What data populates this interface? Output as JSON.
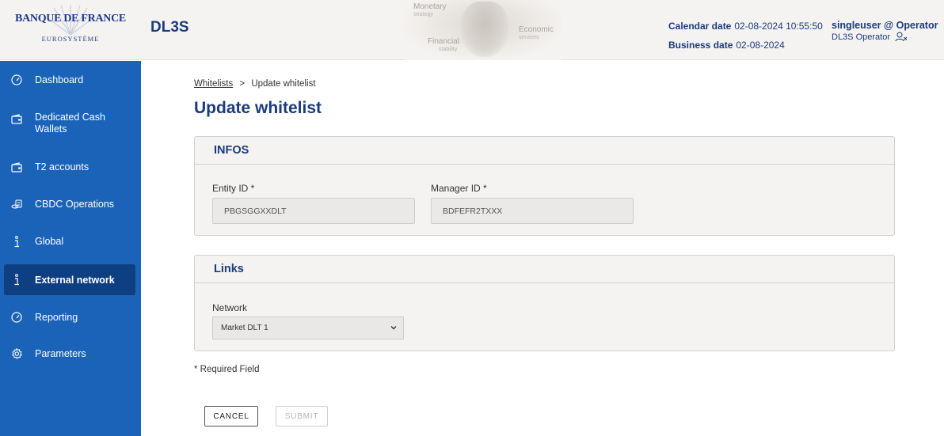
{
  "header": {
    "logo_title": "BANQUE DE FRANCE",
    "logo_subtitle": "EUROSYSTÈME",
    "app_name": "DL3S",
    "banner": {
      "monetary": "Monetary",
      "strategy": "strategy",
      "economic": "Economic",
      "services": "services",
      "financial": "Financial",
      "stability": "stability"
    },
    "calendar_label": "Calendar date",
    "calendar_value": "02-08-2024 10:55:50",
    "business_label": "Business date",
    "business_value": "02-08-2024",
    "user_name": "singleuser @ Operator",
    "user_role": "DL3S Operator",
    "logout_icon": "user-x-icon"
  },
  "sidebar": {
    "items": [
      {
        "label": "Dashboard",
        "icon": "gauge-icon"
      },
      {
        "label": "Dedicated Cash Wallets",
        "icon": "wallet-icon"
      },
      {
        "label": "T2 accounts",
        "icon": "wallet-icon"
      },
      {
        "label": "CBDC Operations",
        "icon": "coins-icon"
      },
      {
        "label": "Global",
        "icon": "info-icon"
      },
      {
        "label": "External network",
        "icon": "info-icon",
        "active": true
      },
      {
        "label": "Reporting",
        "icon": "gauge-icon"
      },
      {
        "label": "Parameters",
        "icon": "gear-icon"
      }
    ],
    "accent": "#1a63b8",
    "active_bg": "#0d3f82"
  },
  "breadcrumb": {
    "parent": "Whitelists",
    "separator": ">",
    "current": "Update whitelist"
  },
  "page_title": "Update whitelist",
  "infos": {
    "title": "INFOS",
    "entity_label": "Entity ID *",
    "entity_value": "PBGSGGXXDLT",
    "manager_label": "Manager ID *",
    "manager_value": "BDFEFR2TXXX"
  },
  "links": {
    "title": "Links",
    "network_label": "Network",
    "network_value": "Market DLT 1"
  },
  "required_note": "* Required Field",
  "buttons": {
    "cancel": "CANCEL",
    "submit": "SUBMIT"
  }
}
